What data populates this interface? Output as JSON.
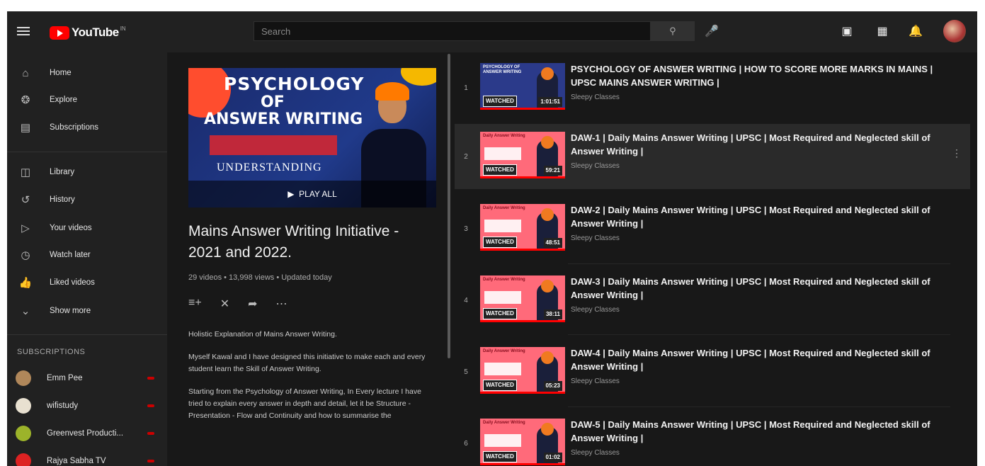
{
  "topbar": {
    "logo_text": "YouTube",
    "logo_sup": "IN",
    "search_placeholder": "Search",
    "icons": [
      "menu-icon",
      "search-icon",
      "mic-icon",
      "create-video-icon",
      "apps-grid-icon",
      "notifications-bell-icon"
    ]
  },
  "sidebar": {
    "items": [
      {
        "label": "Home",
        "icon": "home-icon"
      },
      {
        "label": "Explore",
        "icon": "compass-icon"
      },
      {
        "label": "Subscriptions",
        "icon": "subscriptions-icon"
      },
      {
        "label": "Library",
        "icon": "library-icon"
      },
      {
        "label": "History",
        "icon": "history-icon"
      },
      {
        "label": "Your videos",
        "icon": "play-square-icon"
      },
      {
        "label": "Watch later",
        "icon": "clock-icon"
      },
      {
        "label": "Liked videos",
        "icon": "thumbs-up-icon"
      },
      {
        "label": "Show more",
        "icon": "chevron-down-icon"
      }
    ],
    "subscriptions_title": "SUBSCRIPTIONS",
    "subscriptions": [
      {
        "label": "Emm Pee",
        "color": "#b0875a"
      },
      {
        "label": "wifistudy",
        "color": "#e8e0d0"
      },
      {
        "label": "Greenvest Producti...",
        "color": "#9cb32a"
      },
      {
        "label": "Rajya Sabha TV",
        "color": "#d22"
      }
    ]
  },
  "playlist": {
    "thumb_line1": "PSYCHOLOGY",
    "thumb_line2": "OF",
    "thumb_line3": "ANSWER WRITING",
    "thumb_line4": "UNDERSTANDING",
    "play_all": "PLAY ALL",
    "title": "Mains Answer Writing Initiative - 2021 and 2022.",
    "stats": "29 videos • 13,998 views • Updated today",
    "description": [
      "Holistic Explanation of Mains Answer Writing.",
      "Myself Kawal and I have designed this initiative to make each and every student learn the Skill of Answer Writing.",
      "Starting from the Psychology of Answer Writing, In Every lecture I have tried to explain every answer in depth and detail, let it be Structure - Presentation - Flow and Continuity and how to summarise the"
    ]
  },
  "videos": [
    {
      "index": "1",
      "title": "PSYCHOLOGY OF ANSWER WRITING | HOW TO SCORE MORE MARKS IN MAINS | UPSC MAINS ANSWER WRITING |",
      "channel": "Sleepy Classes",
      "watched": "WATCHED",
      "duration": "1:01:51",
      "thumb_head": "PSYCHOLOGY OF ANSWER WRITING"
    },
    {
      "index": "2",
      "title": "DAW-1 | Daily Mains Answer Writing | UPSC | Most Required and Neglected skill of Answer Writing |",
      "channel": "Sleepy Classes",
      "watched": "WATCHED",
      "duration": "59:21",
      "thumb_head": "Daily Answer Writing"
    },
    {
      "index": "3",
      "title": "DAW-2 | Daily Mains Answer Writing | UPSC | Most Required and Neglected skill of Answer Writing |",
      "channel": "Sleepy Classes",
      "watched": "WATCHED",
      "duration": "48:51",
      "thumb_head": "Daily Answer Writing"
    },
    {
      "index": "4",
      "title": "DAW-3 | Daily Mains Answer Writing | UPSC | Most Required and Neglected skill of Answer Writing |",
      "channel": "Sleepy Classes",
      "watched": "WATCHED",
      "duration": "38:11",
      "thumb_head": "Daily Answer Writing"
    },
    {
      "index": "5",
      "title": "DAW-4 | Daily Mains Answer Writing | UPSC | Most Required and Neglected skill of Answer Writing |",
      "channel": "Sleepy Classes",
      "watched": "WATCHED",
      "duration": "05:23",
      "thumb_head": "Daily Answer Writing"
    },
    {
      "index": "6",
      "title": "DAW-5 | Daily Mains Answer Writing | UPSC | Most Required and Neglected skill of Answer Writing |",
      "channel": "Sleepy Classes",
      "watched": "WATCHED",
      "duration": "01:02",
      "thumb_head": "Daily Answer Writing"
    }
  ],
  "colors": {
    "accent": "#ff0000",
    "background": "#181818",
    "surface": "#212121"
  }
}
